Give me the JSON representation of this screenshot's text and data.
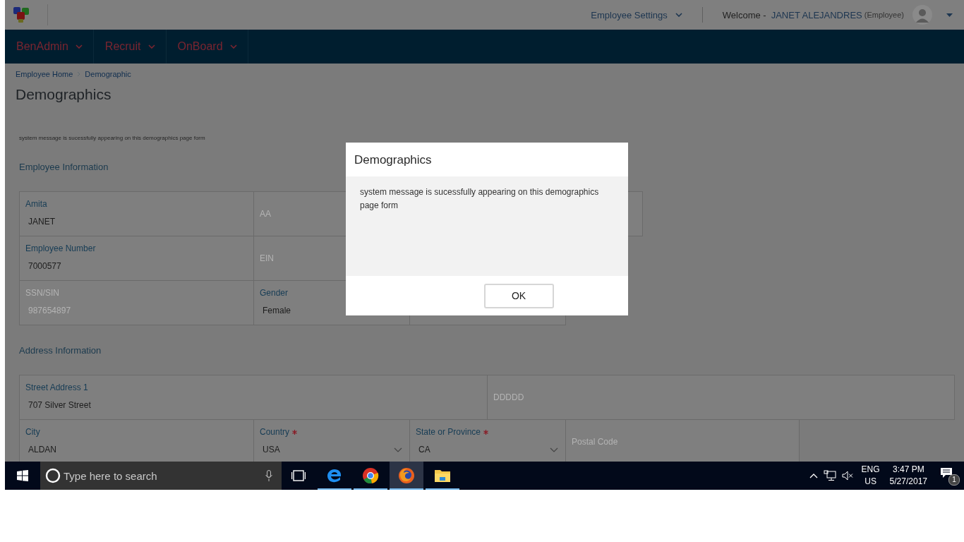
{
  "top_bar": {
    "settings_menu": "Employee Settings",
    "welcome_label": "Welcome -",
    "user_name": "JANET ALEJANDRES",
    "user_role": "(Employee)"
  },
  "nav": [
    {
      "label": "BenAdmin"
    },
    {
      "label": "Recruit"
    },
    {
      "label": "OnBoard"
    }
  ],
  "breadcrumb": [
    "Employee Home",
    "Demographic"
  ],
  "page_title": "Demographics",
  "system_message": "system message is sucessfully appearing on this demographics page form",
  "sections": [
    {
      "title": "Employee Information",
      "rows": [
        [
          {
            "kind": "text",
            "label": "Amita",
            "value": "JANET",
            "disabled": false
          },
          {
            "kind": "text",
            "placeholder": "AA",
            "disabled": false
          },
          {
            "kind": "empty"
          }
        ],
        [
          {
            "kind": "text",
            "label": "Employee Number",
            "value": "7000577",
            "disabled": false
          },
          {
            "kind": "text",
            "placeholder": "EIN",
            "disabled": false
          }
        ],
        [
          {
            "kind": "text",
            "label": "SSN/SIN",
            "value": "987654897",
            "disabled": true
          },
          {
            "kind": "text",
            "label": "Gender",
            "value": "Female",
            "disabled": false
          },
          {
            "kind": "empty"
          }
        ]
      ]
    },
    {
      "title": "Address Information",
      "rows": [
        [
          {
            "kind": "text",
            "label": "Street Address 1",
            "value": "707 Silver Street",
            "disabled": false
          },
          {
            "kind": "text",
            "placeholder": "DDDDD",
            "disabled": false
          }
        ],
        [
          {
            "kind": "text",
            "label": "City",
            "value": "ALDAN",
            "disabled": false
          },
          {
            "kind": "select",
            "label": "Country",
            "value": "USA",
            "required": true,
            "disabled": false
          },
          {
            "kind": "select",
            "label": "State or Province",
            "value": "CA",
            "required": true,
            "disabled": false
          },
          {
            "kind": "text",
            "placeholder": "Postal Code",
            "disabled": false
          }
        ]
      ]
    }
  ],
  "dialog": {
    "title": "Demographics",
    "message": "system message is sucessfully appearing on this demographics page form",
    "buttons": [
      "OK"
    ]
  },
  "taskbar": {
    "search_placeholder": "Type here to search",
    "apps": [
      {
        "kind": "edge",
        "running": true,
        "selected": false
      },
      {
        "kind": "chrome",
        "running": true,
        "selected": false
      },
      {
        "kind": "firefox",
        "running": true,
        "selected": true
      },
      {
        "kind": "folder",
        "running": true,
        "selected": false
      }
    ],
    "language": "ENG",
    "region": "US",
    "time": "3:47 PM",
    "date": "5/27/2017",
    "notifications": "1"
  }
}
